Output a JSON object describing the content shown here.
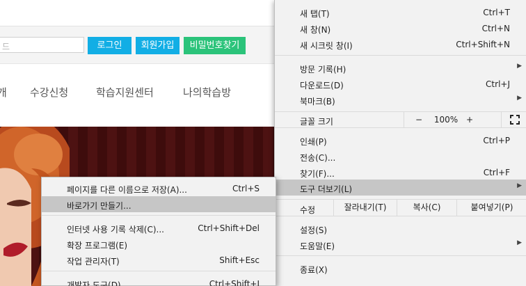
{
  "site": {
    "password_placeholder": "드",
    "login_label": "로그인",
    "join_label": "회원가입",
    "find_pw_label": "비밀번호찾기",
    "nav": [
      "개",
      "수강신청",
      "학습지원센터",
      "나의학습방"
    ],
    "colors": {
      "login_button": "#12aee5",
      "find_button": "#2bc37a",
      "hero_bg": "#3e0c0c"
    }
  },
  "menu": {
    "group1": [
      {
        "label": "새 탭(T)",
        "shortcut": "Ctrl+T"
      },
      {
        "label": "새 창(N)",
        "shortcut": "Ctrl+N"
      },
      {
        "label": "새 시크릿 창(I)",
        "shortcut": "Ctrl+Shift+N"
      }
    ],
    "group2": [
      {
        "label": "방문 기록(H)",
        "arrow": "▶"
      },
      {
        "label": "다운로드(D)",
        "shortcut": "Ctrl+J"
      },
      {
        "label": "북마크(B)",
        "arrow": "▶"
      }
    ],
    "zoom": {
      "label": "글꼴 크기",
      "minus": "−",
      "value": "100%",
      "plus": "+",
      "fullscreen_icon": "fullscreen-icon"
    },
    "group3": [
      {
        "label": "인쇄(P)",
        "shortcut": "Ctrl+P"
      },
      {
        "label": "전송(C)..."
      },
      {
        "label": "찾기(F)...",
        "shortcut": "Ctrl+F"
      },
      {
        "label": "도구 더보기(L)",
        "arrow": "▶"
      }
    ],
    "edit": {
      "label": "수정",
      "cut": "잘라내기(T)",
      "copy": "복사(C)",
      "paste": "붙여넣기(P)"
    },
    "group4": [
      {
        "label": "설정(S)"
      },
      {
        "label": "도움말(E)",
        "arrow": "▶"
      }
    ],
    "exit": {
      "label": "종료(X)"
    }
  },
  "submenu": {
    "items": [
      {
        "label": "페이지를 다른 이름으로 저장(A)...",
        "shortcut": "Ctrl+S"
      },
      {
        "label": "바로가기 만들기..."
      },
      {
        "label": "인터넷 사용 기록 삭제(C)...",
        "shortcut": "Ctrl+Shift+Del"
      },
      {
        "label": "확장 프로그램(E)"
      },
      {
        "label": "작업 관리자(T)",
        "shortcut": "Shift+Esc"
      },
      {
        "label": "개발자 도구(D)",
        "shortcut": "Ctrl+Shift+I"
      }
    ]
  }
}
